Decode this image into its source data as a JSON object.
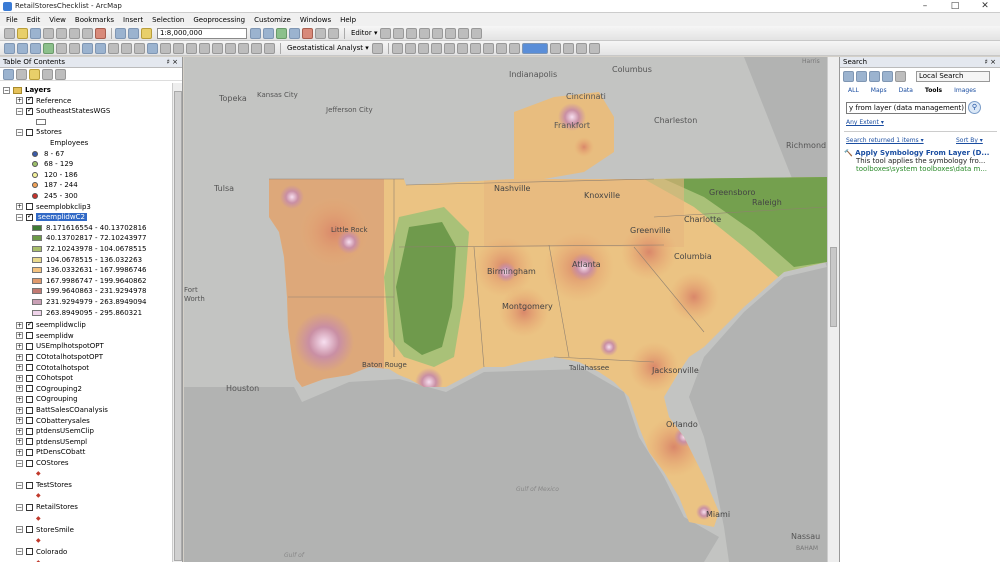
{
  "window": {
    "title": "RetailStoresChecklist - ArcMap",
    "controls": [
      "–",
      "□",
      "✕"
    ]
  },
  "menu": [
    "File",
    "Edit",
    "View",
    "Bookmarks",
    "Insert",
    "Selection",
    "Geoprocessing",
    "Customize",
    "Windows",
    "Help"
  ],
  "toolbar": {
    "scale": "1:8,000,000",
    "editor_label": "Editor ▾",
    "geostat_label": "Geostatistical Analyst ▾"
  },
  "toc": {
    "title": "Table Of Contents",
    "pin": "♯ ×",
    "root": "Layers",
    "layers_top": [
      {
        "name": "Reference",
        "checked": true,
        "expanded": false
      },
      {
        "name": "SoutheastStatesWGS",
        "checked": true,
        "expanded": true
      },
      {
        "name": "5stores",
        "checked": false,
        "expanded": true
      }
    ],
    "employees_label": "Employees",
    "employee_classes": [
      {
        "label": "8 - 67",
        "color": "#3b5aa8"
      },
      {
        "label": "68 - 129",
        "color": "#9bbf6a"
      },
      {
        "label": "120 - 186",
        "color": "#f2f09b"
      },
      {
        "label": "187 - 244",
        "color": "#f0a259"
      },
      {
        "label": "245 - 300",
        "color": "#c7322b"
      }
    ],
    "layer_clip3": {
      "name": "seemplobkclip3",
      "checked": false
    },
    "layer_selected": {
      "name": "seemplidwC2",
      "checked": true
    },
    "raster_classes": [
      {
        "label": "8.171616554 - 40.13702816",
        "color": "#3f7a35"
      },
      {
        "label": "40.13702817 - 72.10243977",
        "color": "#6c9a48"
      },
      {
        "label": "72.10243978 - 104.0678515",
        "color": "#a8be6b"
      },
      {
        "label": "104.0678515 - 136.032263",
        "color": "#e9d98c"
      },
      {
        "label": "136.0332631 - 167.9986746",
        "color": "#f4c27f"
      },
      {
        "label": "167.9986747 - 199.9640862",
        "color": "#e09a6d"
      },
      {
        "label": "199.9640863 - 231.9294978",
        "color": "#c27a73"
      },
      {
        "label": "231.9294979 - 263.8949094",
        "color": "#c9a0b5"
      },
      {
        "label": "263.8949095 - 295.860321",
        "color": "#efd3ea"
      }
    ],
    "layers_bottom": [
      {
        "name": "seemplidwclip",
        "checked": true,
        "expanded": false
      },
      {
        "name": "seemplidw",
        "checked": false,
        "expanded": false
      },
      {
        "name": "USEmplhotspotOPT",
        "checked": false,
        "expanded": false
      },
      {
        "name": "COtotalhotspotOPT",
        "checked": false,
        "expanded": false
      },
      {
        "name": "COtotalhotspot",
        "checked": false,
        "expanded": false
      },
      {
        "name": "COhotspot",
        "checked": false,
        "expanded": false
      },
      {
        "name": "COgrouping2",
        "checked": false,
        "expanded": false
      },
      {
        "name": "COgrouping",
        "checked": false,
        "expanded": false
      },
      {
        "name": "BattSalesCOanalysis",
        "checked": false,
        "expanded": false
      },
      {
        "name": "CObatterysales",
        "checked": false,
        "expanded": false
      },
      {
        "name": "ptdensUSemClip",
        "checked": false,
        "expanded": false
      },
      {
        "name": "ptdensUSempl",
        "checked": false,
        "expanded": false
      },
      {
        "name": "PtDensCObatt",
        "checked": false,
        "expanded": false
      },
      {
        "name": "COStores",
        "checked": false,
        "expanded": true
      },
      {
        "name": "TestStores",
        "checked": false,
        "expanded": true
      },
      {
        "name": "RetailStores",
        "checked": false,
        "expanded": true
      },
      {
        "name": "StoreSmile",
        "checked": false,
        "expanded": true
      },
      {
        "name": "Colorado",
        "checked": false,
        "expanded": true
      }
    ]
  },
  "map": {
    "labels": {
      "indianapolis": "Indianapolis",
      "columbus": "Columbus",
      "topeka": "Topeka",
      "kansas_city": "Kansas City",
      "jefferson_city": "Jefferson City",
      "cincinnati": "Cincinnati",
      "frankfort": "Frankfort",
      "charleston": "Charleston",
      "richmond": "Richmond",
      "tulsa": "Tulsa",
      "nashville": "Nashville",
      "knoxville": "Knoxville",
      "greensboro": "Greensboro",
      "raleigh": "Raleigh",
      "charlotte": "Charlotte",
      "little_rock": "Little Rock",
      "greenville": "Greenville",
      "birmingham": "Birmingham",
      "atlanta": "Atlanta",
      "columbia": "Columbia",
      "montgomery": "Montgomery",
      "fort": "Fort",
      "worth": "Worth",
      "baton_rouge": "Baton Rouge",
      "houston": "Houston",
      "tallahassee": "Tallahassee",
      "jacksonville": "Jacksonville",
      "orlando": "Orlando",
      "miami": "Miami",
      "nassau": "Nassau",
      "bahamas": "BAHAM",
      "gulf_of_mexico": "Gulf of Mexico",
      "gulf_bottom": "Gulf of",
      "harris": "Harris"
    }
  },
  "search": {
    "title": "Search",
    "local_search": "Local Search",
    "tabs": [
      "ALL",
      "Maps",
      "Data",
      "Tools",
      "Images"
    ],
    "active_tab": "Tools",
    "query": "y from layer (data management)",
    "any_extent": "Any Extent ▾",
    "returned": "Search returned 1 items ▾",
    "sort_by": "Sort By ▾",
    "result_title": "Apply Symbology From Layer (D...",
    "result_desc": "This tool applies the symbology fro...",
    "result_path": "toolboxes\\system toolboxes\\data m..."
  }
}
